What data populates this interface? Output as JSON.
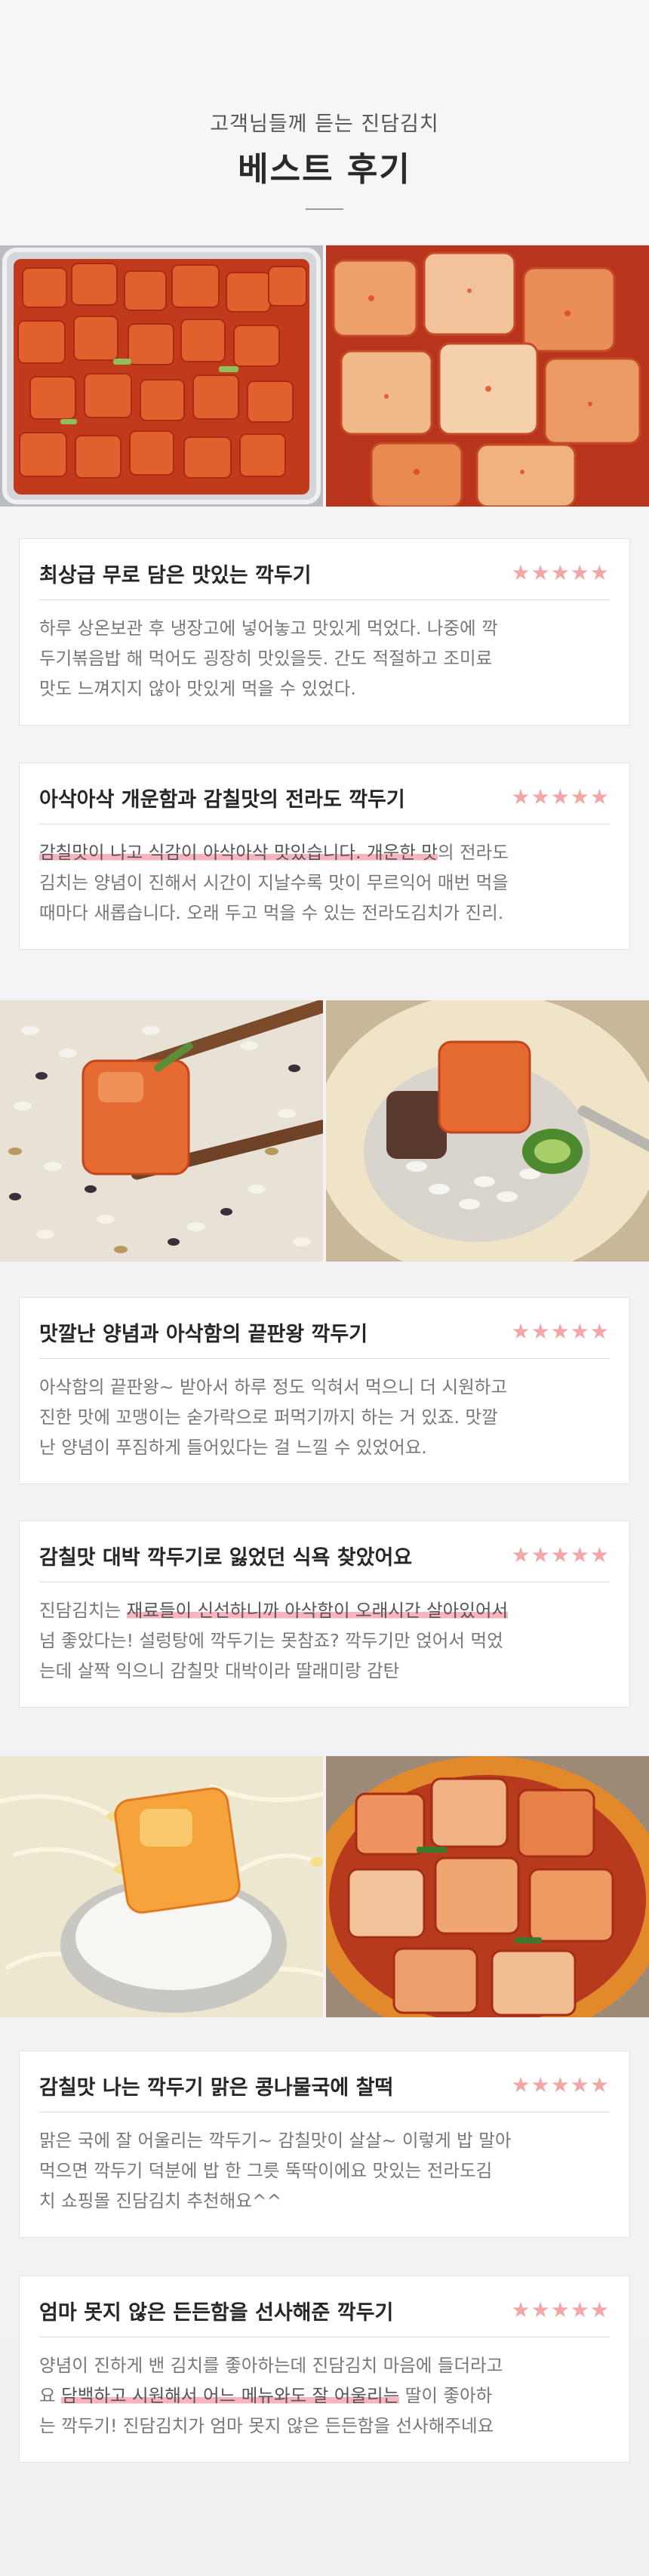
{
  "header": {
    "subtitle": "고객님들께 듣는 진담김치",
    "title": "베스트 후기"
  },
  "rating_glyph": "★★★★★",
  "colors": {
    "star": "#f3a6a6",
    "highlight": "#f7b3be",
    "card_border": "#e2e2e6"
  },
  "photos": [
    {
      "left": "kkakdugi-container-photo",
      "right": "kkakdugi-closeup-photo"
    },
    {
      "left": "kkakdugi-chopsticks-rice-photo",
      "right": "kkakdugi-spoon-rice-photo"
    },
    {
      "left": "kkakdugi-bean-sprout-soup-photo",
      "right": "kkakdugi-bowl-photo"
    }
  ],
  "reviews": [
    {
      "title": "최상급 무로 담은 맛있는 깍두기",
      "lines": [
        [
          "하루 상온보관 후 냉장고에 넣어놓고 맛있게 먹었다. 나중에 깍"
        ],
        [
          "두기볶음밥 해 먹어도 굉장히 맛있을듯. 간도 적절하고 조미료"
        ],
        [
          "맛도 느껴지지 않아 맛있게 먹을 수 있었다."
        ]
      ]
    },
    {
      "title": "아삭아삭 개운함과 감칠맛의 전라도 깍두기",
      "lines": [
        [
          "",
          "감칠맛이 나고 식감이 아삭아삭 맛있습니다. 개운한 맛",
          "의 전라도"
        ],
        [
          "김치는 양념이 진해서 시간이 지날수록 맛이 무르익어 매번 먹을"
        ],
        [
          "때마다 새롭습니다. 오래 두고 먹을 수 있는 전라도김치가 진리."
        ]
      ]
    },
    {
      "title": "맛깔난 양념과 아삭함의 끝판왕 깍두기",
      "lines": [
        [
          "아삭함의 끝판왕~ 받아서 하루 정도 익혀서 먹으니 더 시원하고"
        ],
        [
          "진한 맛에 꼬맹이는 숟가락으로 퍼먹기까지 하는 거 있죠. 맛깔"
        ],
        [
          "난 양념이 푸짐하게 들어있다는 걸 느낄 수 있었어요."
        ]
      ]
    },
    {
      "title": "감칠맛 대박 깍두기로 잃었던 식욕 찾았어요",
      "lines": [
        [
          "진담김치는 ",
          "재료들이 신선하니까 아삭함이 오래시간 살아있어서",
          ""
        ],
        [
          "넘 좋았다는! 설렁탕에 깍두기는 못참죠? 깍두기만 얹어서 먹었"
        ],
        [
          "는데 살짝 익으니 감칠맛 대박이라 딸래미랑 감탄"
        ]
      ]
    },
    {
      "title": "감칠맛 나는 깍두기 맑은 콩나물국에 찰떡",
      "lines": [
        [
          "맑은 국에 잘 어울리는 깍두기~ 감칠맛이 살살~ 이렇게 밥 말아"
        ],
        [
          "먹으면 깍두기 덕분에 밥 한 그릇 뚝딱이에요 맛있는 전라도김"
        ],
        [
          "치 쇼핑몰 진담김치 추천해요^^"
        ]
      ]
    },
    {
      "title": "엄마 못지 않은 든든함을 선사해준 깍두기",
      "lines": [
        [
          "양념이 진하게 밴 김치를 좋아하는데 진담김치 마음에 들더라고"
        ],
        [
          "요 ",
          "담백하고 시원해서 어느 메뉴와도 잘 어울리는",
          " 딸이 좋아하"
        ],
        [
          "는 깍두기! 진담김치가 엄마 못지 않은 든든함을 선사해주네요"
        ]
      ]
    }
  ]
}
